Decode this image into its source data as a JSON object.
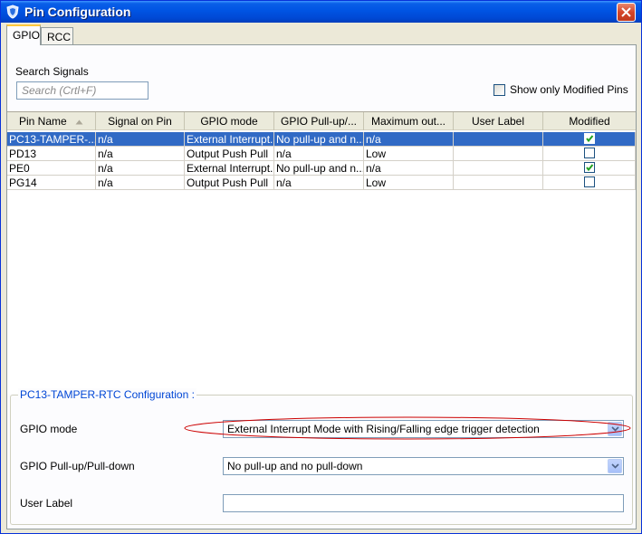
{
  "window": {
    "title": "Pin Configuration"
  },
  "tabs": [
    {
      "label": "GPIO"
    },
    {
      "label": "RCC"
    }
  ],
  "search": {
    "label": "Search Signals",
    "placeholder": "Search (Crtl+F)"
  },
  "filter": {
    "label": "Show only Modified Pins",
    "checked": false
  },
  "table": {
    "columns": [
      "Pin Name",
      "Signal on Pin",
      "GPIO mode",
      "GPIO Pull-up/...",
      "Maximum out...",
      "User Label",
      "Modified"
    ],
    "rows": [
      {
        "pin": "PC13-TAMPER-...",
        "signal": "n/a",
        "mode": "External Interrupt...",
        "pull": "No pull-up and n...",
        "max": "n/a",
        "label": "",
        "modified": true,
        "selected": true
      },
      {
        "pin": "PD13",
        "signal": "n/a",
        "mode": "Output Push Pull",
        "pull": "n/a",
        "max": "Low",
        "label": "",
        "modified": false,
        "selected": false
      },
      {
        "pin": "PE0",
        "signal": "n/a",
        "mode": "External Interrupt...",
        "pull": "No pull-up and n...",
        "max": "n/a",
        "label": "",
        "modified": true,
        "selected": false
      },
      {
        "pin": "PG14",
        "signal": "n/a",
        "mode": "Output Push Pull",
        "pull": "n/a",
        "max": "Low",
        "label": "",
        "modified": false,
        "selected": false
      }
    ]
  },
  "config": {
    "title": "PC13-TAMPER-RTC Configuration :",
    "gpio_mode_label": "GPIO mode",
    "gpio_mode_value": "External Interrupt Mode with Rising/Falling edge trigger detection",
    "pull_label": "GPIO Pull-up/Pull-down",
    "pull_value": "No pull-up and no pull-down",
    "user_label_label": "User Label",
    "user_label_value": ""
  },
  "colors": {
    "selection": "#316ac5",
    "accent_title": "#0046d5",
    "annotation": "#cc0000"
  }
}
